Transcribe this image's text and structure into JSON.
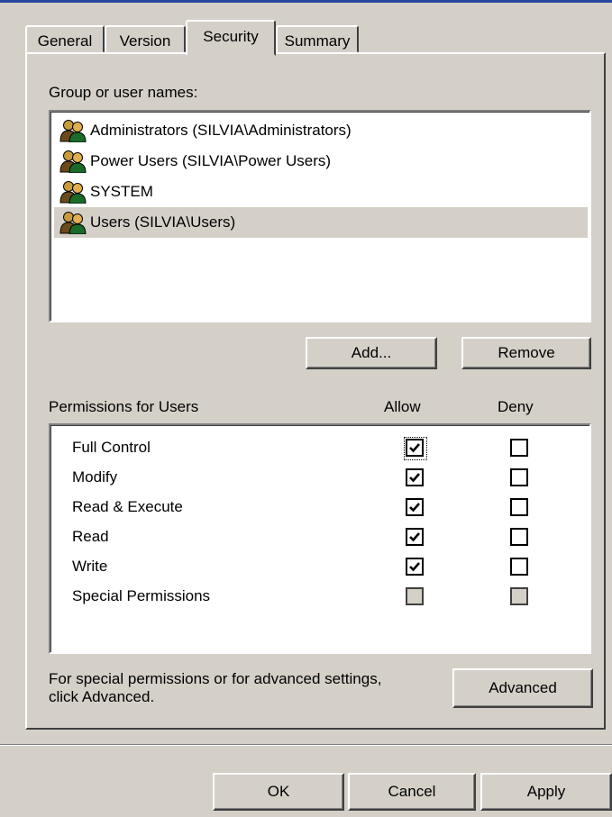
{
  "tabs": [
    {
      "label": "General"
    },
    {
      "label": "Version"
    },
    {
      "label": "Security"
    },
    {
      "label": "Summary"
    }
  ],
  "group_label": "Group or user names:",
  "users": [
    {
      "name": "Administrators (SILVIA\\Administrators)",
      "icon": "user-group-icon"
    },
    {
      "name": "Power Users (SILVIA\\Power Users)",
      "icon": "user-group-icon"
    },
    {
      "name": "SYSTEM",
      "icon": "user-group-icon"
    },
    {
      "name": "Users (SILVIA\\Users)",
      "icon": "user-group-icon",
      "selected": true
    }
  ],
  "buttons": {
    "add": "Add...",
    "remove": "Remove",
    "advanced": "Advanced",
    "ok": "OK",
    "cancel": "Cancel",
    "apply": "Apply"
  },
  "permissions": {
    "heading": "Permissions for Users",
    "allow_label": "Allow",
    "deny_label": "Deny",
    "rows": [
      {
        "name": "Full Control",
        "allow": true,
        "deny": false
      },
      {
        "name": "Modify",
        "allow": true,
        "deny": false
      },
      {
        "name": "Read & Execute",
        "allow": true,
        "deny": false
      },
      {
        "name": "Read",
        "allow": true,
        "deny": false
      },
      {
        "name": "Write",
        "allow": true,
        "deny": false
      },
      {
        "name": "Special Permissions",
        "allow": false,
        "deny": false,
        "disabled": true
      }
    ]
  },
  "advanced_note_line1": "For special permissions or for advanced settings,",
  "advanced_note_line2": "click Advanced.",
  "colors": {
    "face": "#d4d0c8",
    "title_accent": "#27479e"
  }
}
